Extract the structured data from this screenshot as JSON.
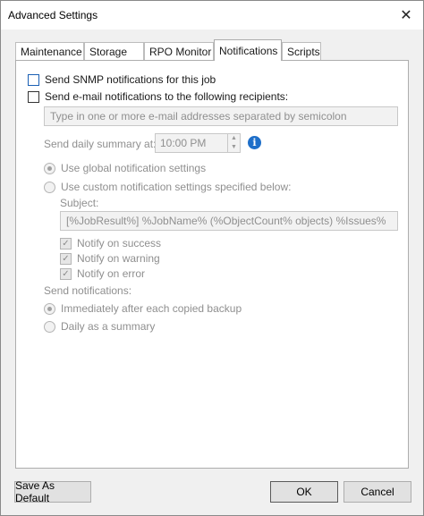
{
  "window": {
    "title": "Advanced Settings",
    "close_glyph": "✕"
  },
  "tabs": [
    {
      "label": "Maintenance"
    },
    {
      "label": "Storage"
    },
    {
      "label": "RPO Monitor"
    },
    {
      "label": "Notifications"
    },
    {
      "label": "Scripts"
    }
  ],
  "active_tab": "Notifications",
  "notifications": {
    "snmp_label": "Send SNMP notifications for this job",
    "snmp_checked": false,
    "email_label": "Send e-mail notifications to the following recipients:",
    "email_checked": false,
    "recipients_placeholder": "Type in one or more e-mail addresses separated by semicolon",
    "daily_summary_label": "Send daily summary at:",
    "daily_summary_time": "10:00 PM",
    "use_global_label": "Use global notification settings",
    "use_global_selected": true,
    "use_custom_label": "Use custom notification settings specified below:",
    "use_custom_selected": false,
    "subject_label": "Subject:",
    "subject_value": "[%JobResult%] %JobName% (%ObjectCount% objects) %Issues%",
    "notify_success_label": "Notify on success",
    "notify_warning_label": "Notify on warning",
    "notify_error_label": "Notify on error",
    "notify_checked_glyph": "✓",
    "send_notifications_label": "Send notifications:",
    "immediately_label": "Immediately after each copied backup",
    "immediately_selected": true,
    "daily_label": "Daily as a summary",
    "daily_selected": false
  },
  "icons": {
    "info": "i",
    "spin_up": "▲",
    "spin_down": "▼"
  },
  "buttons": {
    "save_default": "Save As Default",
    "ok": "OK",
    "cancel": "Cancel"
  },
  "colors": {
    "info_icon": "#1e6fc9",
    "snmp_checkbox_border": "#1a5fb4"
  }
}
